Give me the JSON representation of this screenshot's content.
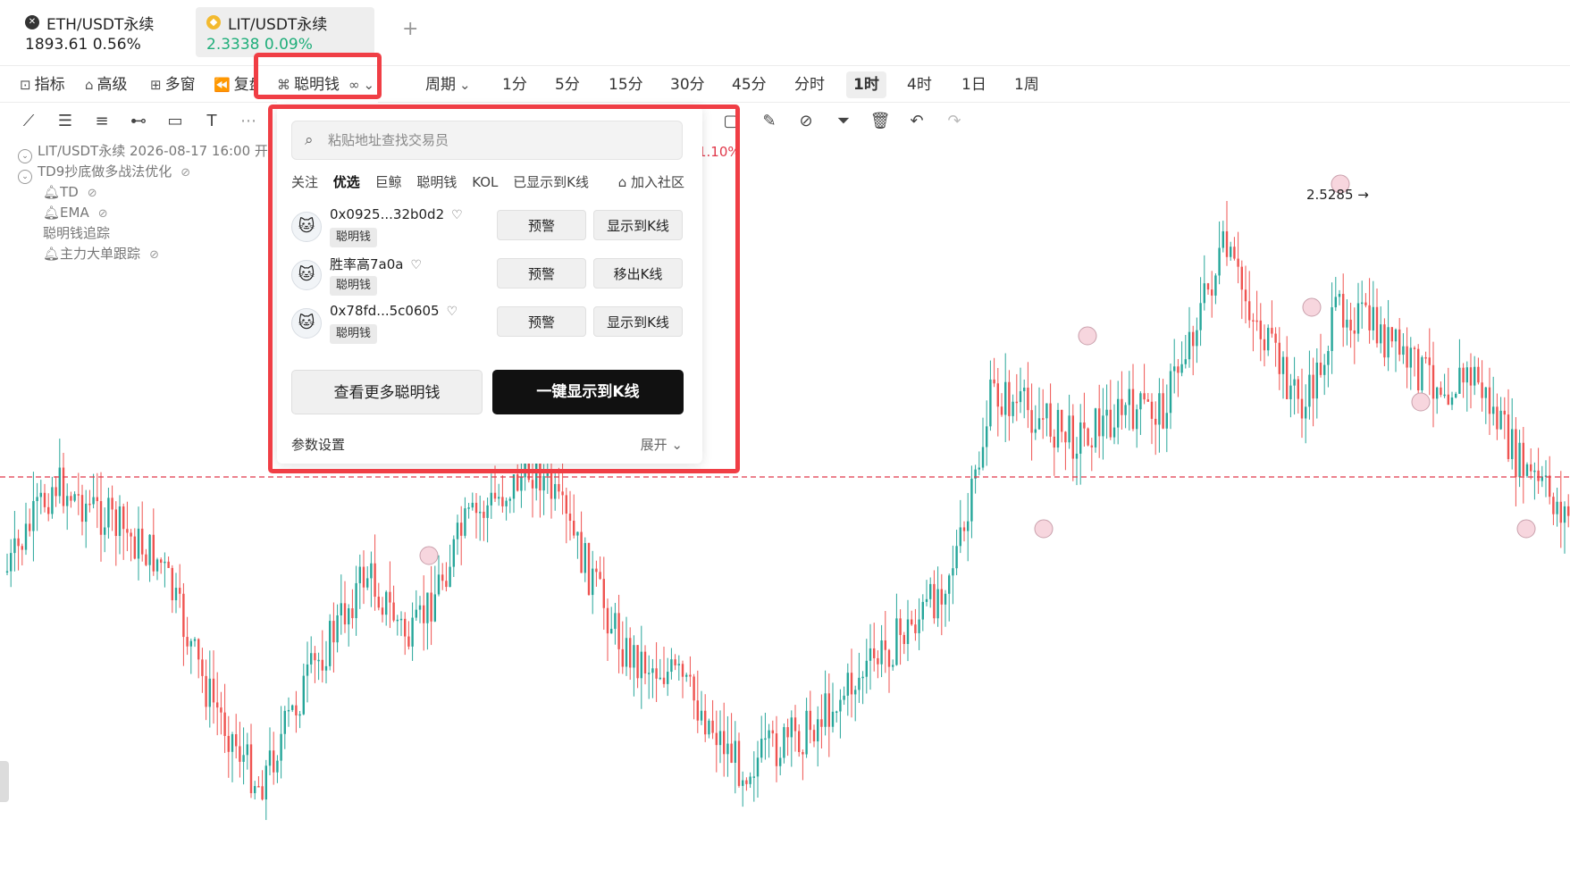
{
  "tabs": [
    {
      "name": "ETH/USDT永续",
      "price": "1893.61",
      "change": "0.56%"
    },
    {
      "name": "LIT/USDT永续",
      "price": "2.3338",
      "change": "0.09%"
    }
  ],
  "toolbar": {
    "indicator": "指标",
    "advanced": "高级",
    "multi_window": "多窗",
    "replay": "复盘",
    "smart_money": "聪明钱",
    "period": "周期",
    "intervals": [
      "1分",
      "5分",
      "15分",
      "30分",
      "45分",
      "分时",
      "1时",
      "4时",
      "1日",
      "1周"
    ],
    "active_interval": "1时"
  },
  "legend": {
    "symbol_line": "LIT/USDT永续 2026-08-17 16:00 开",
    "strategy": "TD9抄底做多战法优化",
    "sub": [
      "TD",
      "EMA",
      "聪明钱追踪",
      "主力大单跟踪"
    ]
  },
  "chart_labels": {
    "pct": "1.10%",
    "price_high": "2.5285 →"
  },
  "panel": {
    "search_placeholder": "粘贴地址查找交易员",
    "filters": [
      "关注",
      "优选",
      "巨鲸",
      "聪明钱",
      "KOL",
      "已显示到K线"
    ],
    "selected_filter": "优选",
    "join_community": "加入社区",
    "traders": [
      {
        "name": "0x0925...32b0d2",
        "badge": "聪明钱",
        "alert": "预警",
        "action": "显示到K线"
      },
      {
        "name": "胜率高7a0a",
        "badge": "聪明钱",
        "alert": "预警",
        "action": "移出K线"
      },
      {
        "name": "0x78fd...5c0605",
        "badge": "聪明钱",
        "alert": "预警",
        "action": "显示到K线"
      }
    ],
    "view_more": "查看更多聪明钱",
    "show_all": "一键显示到K线",
    "params": "参数设置",
    "expand": "展开"
  },
  "colors": {
    "up": "#26a69a",
    "down": "#ef5350",
    "ref_line": "#e0384a",
    "highlight": "#f03e45"
  }
}
